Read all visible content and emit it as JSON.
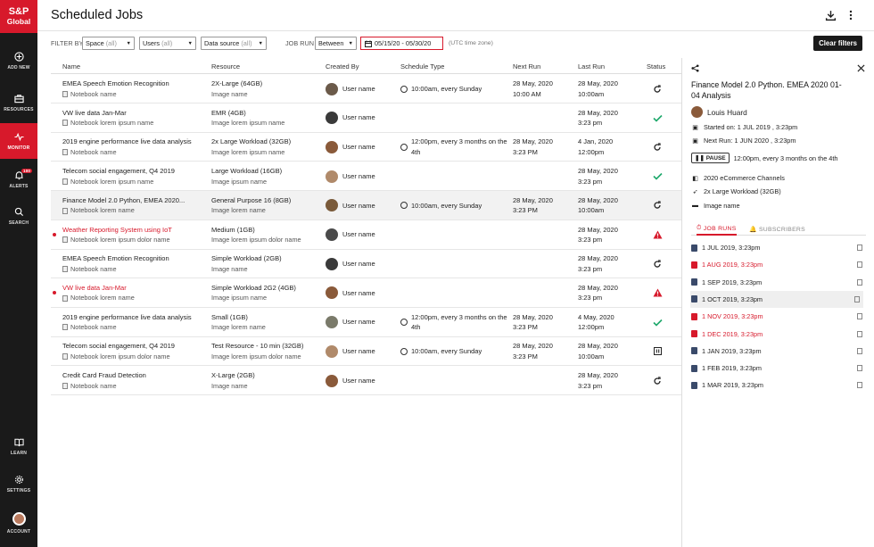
{
  "brand": {
    "line1": "S&P",
    "line2": "Global"
  },
  "nav": {
    "add_new": "ADD NEW",
    "resources": "RESOURCES",
    "monitor": "MONITOR",
    "alerts": "ALERTS",
    "alerts_badge": "100",
    "search": "SEARCH",
    "learn": "LEARN",
    "settings": "SETTINGS",
    "account": "ACCOUNT"
  },
  "header": {
    "title": "Scheduled Jobs"
  },
  "filters": {
    "filter_by": "FILTER BY",
    "space": "Space",
    "space_val": "(all)",
    "users": "Users",
    "users_val": "(all)",
    "data_source": "Data source",
    "data_source_val": "(all)",
    "job_run": "JOB RUN",
    "between": "Between",
    "date_range": "05/15/20 - 05/30/20",
    "tz": "(UTC time zone)",
    "clear": "Clear filters"
  },
  "columns": {
    "name": "Name",
    "resource": "Resource",
    "created_by": "Created By",
    "schedule_type": "Schedule Type",
    "next_run": "Next Run",
    "last_run": "Last Run",
    "status": "Status"
  },
  "rows": [
    {
      "name": "EMEA Speech Emotion Recognition",
      "sub": "Notebook name",
      "resource": "2X-Large (64GB)",
      "resource_sub": "Image name",
      "user": "User name",
      "schedule": "10:00am, every Sunday",
      "next": "28 May, 2020",
      "next2": "10:00 AM",
      "last": "28 May, 2020",
      "last2": "10:00am",
      "status": "running",
      "error": false
    },
    {
      "name": "VW live data Jan-Mar",
      "sub": "Notebook lorem ipsum name",
      "resource": "EMR (4GB)",
      "resource_sub": "Image lorem ipsum name",
      "user": "User name",
      "schedule": "",
      "next": "",
      "next2": "",
      "last": "28 May, 2020",
      "last2": "3:23 pm",
      "status": "success",
      "error": false
    },
    {
      "name": "2019 engine performance live data analysis",
      "sub": "Notebook name",
      "resource": "2x Large Workload (32GB)",
      "resource_sub": "Image lorem ipsum name",
      "user": "User name",
      "schedule": "12:00pm, every 3 months on the 4th",
      "next": "28 May, 2020",
      "next2": "3:23 PM",
      "last": "4 Jan, 2020",
      "last2": "12:00pm",
      "status": "running",
      "error": false
    },
    {
      "name": "Telecom social engagement, Q4 2019",
      "sub": "Notebook lorem ipsum name",
      "resource": "Large Workload (16GB)",
      "resource_sub": "Image ipsum name",
      "user": "User name",
      "schedule": "",
      "next": "",
      "next2": "",
      "last": "28 May, 2020",
      "last2": "3:23 pm",
      "status": "success",
      "error": false
    },
    {
      "name": "Finance Model 2.0 Python, EMEA 2020...",
      "sub": "Notebook lorem name",
      "resource": "General Purpose 16 (8GB)",
      "resource_sub": "Image lorem name",
      "user": "User name",
      "schedule": "10:00am, every Sunday",
      "next": "28 May, 2020",
      "next2": "3:23 PM",
      "last": "28 May, 2020",
      "last2": "10:00am",
      "status": "running",
      "error": false
    },
    {
      "name": "Weather Reporting System using IoT",
      "sub": "Notebook lorem ipsum dolor name",
      "resource": "Medium (1GB)",
      "resource_sub": "Image lorem ipsum dolor name",
      "user": "User name",
      "schedule": "",
      "next": "",
      "next2": "",
      "last": "28 May, 2020",
      "last2": "3:23 pm",
      "status": "error",
      "error": true
    },
    {
      "name": "EMEA Speech Emotion Recognition",
      "sub": "Notebook name",
      "resource": "Simple Workload (2GB)",
      "resource_sub": "Image name",
      "user": "User name",
      "schedule": "",
      "next": "",
      "next2": "",
      "last": "28 May, 2020",
      "last2": "3:23 pm",
      "status": "running",
      "error": false
    },
    {
      "name": "VW live data Jan-Mar",
      "sub": "Notebook lorem name",
      "resource": "Simple Workload 2G2 (4GB)",
      "resource_sub": "Image ipsum name",
      "user": "User name",
      "schedule": "",
      "next": "",
      "next2": "",
      "last": "28 May, 2020",
      "last2": "3:23 pm",
      "status": "error",
      "error": true
    },
    {
      "name": "2019 engine performance live data analysis",
      "sub": "Notebook name",
      "resource": "Small (1GB)",
      "resource_sub": "Image lorem name",
      "user": "User name",
      "schedule": "12:00pm, every 3 months on the 4th",
      "next": "28 May, 2020",
      "next2": "3:23 PM",
      "last": "4 May, 2020",
      "last2": "12:00pm",
      "status": "success",
      "error": false
    },
    {
      "name": "Telecom social engagement, Q4 2019",
      "sub": "Notebook lorem ipsum dolor name",
      "resource": "Test Resource - 10 min (32GB)",
      "resource_sub": "Image lorem ipsum dolor name",
      "user": "User name",
      "schedule": "10:00am, every Sunday",
      "next": "28 May, 2020",
      "next2": "3:23 PM",
      "last": "28 May, 2020",
      "last2": "10:00am",
      "status": "paused",
      "error": false
    },
    {
      "name": "Credit Card Fraud Detection",
      "sub": "Notebook name",
      "resource": "X-Large (2GB)",
      "resource_sub": "Image name",
      "user": "User name",
      "schedule": "",
      "next": "",
      "next2": "",
      "last": "28 May, 2020",
      "last2": "3:23 pm",
      "status": "running",
      "error": false
    }
  ],
  "panel": {
    "title": "Finance Model 2.0 Python. EMEA 2020 01-04 Analysis",
    "owner": "Louis Huard",
    "started_label": "Started on:",
    "started": "1 JUL 2019 , 3:23pm",
    "next_label": "Next Run:",
    "next": "1 JUN 2020 , 3:23pm",
    "pause": "PAUSE",
    "schedule": "12:00pm, every 3 months on the 4th",
    "space": "2020 eCommerce Channels",
    "resource": "2x Large Workload (32GB)",
    "image": "Image name",
    "tab_runs": "JOB RUNS",
    "tab_subs": "SUBSCRIBERS",
    "runs": [
      {
        "label": "1 JUL 2019, 3:23pm",
        "error": false
      },
      {
        "label": "1 AUG 2019, 3:23pm",
        "error": true
      },
      {
        "label": "1 SEP 2019, 3:23pm",
        "error": false
      },
      {
        "label": "1 OCT 2019, 3:23pm",
        "error": false
      },
      {
        "label": "1 NOV 2019, 3:23pm",
        "error": true
      },
      {
        "label": "1 DEC 2019, 3:23pm",
        "error": true
      },
      {
        "label": "1 JAN 2019, 3:23pm",
        "error": false
      },
      {
        "label": "1 FEB 2019, 3:23pm",
        "error": false
      },
      {
        "label": "1 MAR 2019, 3:23pm",
        "error": false
      }
    ]
  },
  "colors": {
    "accent": "#d7192b",
    "nav_bg": "#1a1a1a",
    "success": "#1ea86b"
  }
}
